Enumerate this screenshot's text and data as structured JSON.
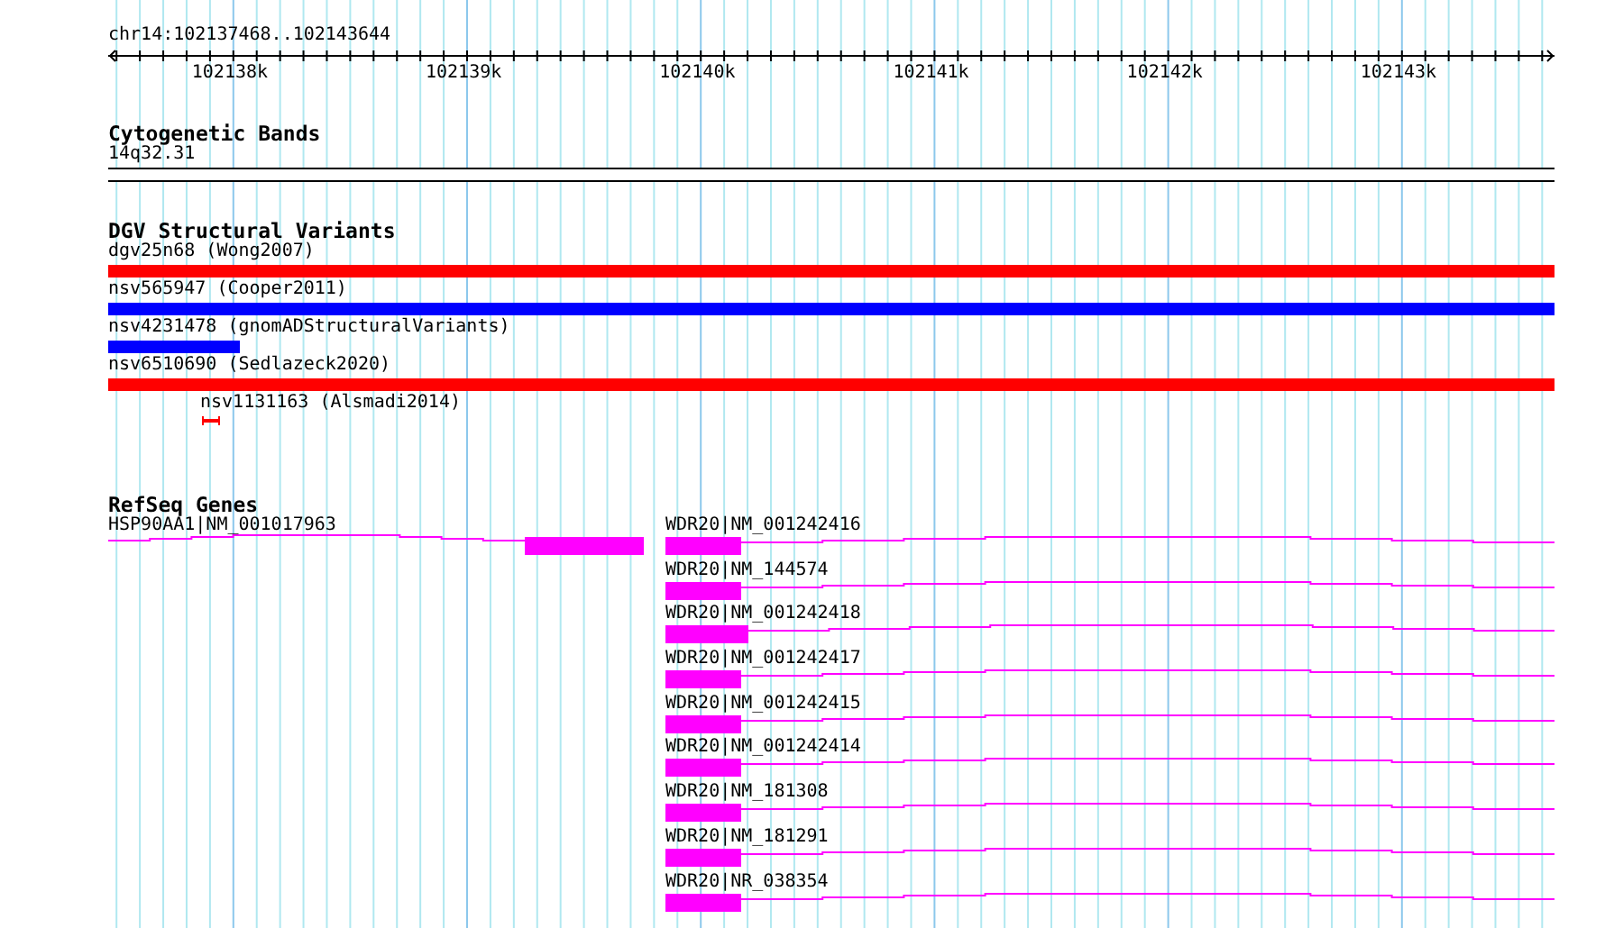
{
  "locus": "chr14:102137468..102143644",
  "ruler": {
    "ticks": [
      "102138k",
      "102139k",
      "102140k",
      "102141k",
      "102142k",
      "102143k"
    ]
  },
  "tracks": [
    {
      "kind": "bands",
      "title": "Cytogenetic Bands",
      "rows": [
        [
          {
            "label": "14q32.31"
          }
        ]
      ]
    },
    {
      "kind": "variants",
      "title": "DGV Structural Variants",
      "rows": [
        [
          {
            "label": "dgv25n68 (Wong2007)",
            "color": "#ff0000"
          }
        ],
        [
          {
            "label": "nsv565947 (Cooper2011)",
            "color": "#0000ff"
          }
        ],
        [
          {
            "label": "nsv4231478 (gnomADStructuralVariants)",
            "color": "#0000ff"
          }
        ],
        [
          {
            "label": "nsv6510690 (Sedlazeck2020)",
            "color": "#ff0000"
          }
        ],
        [
          {
            "label": "nsv1131163 (Alsmadi2014)",
            "color": "#ff0000"
          }
        ]
      ]
    },
    {
      "kind": "genes",
      "title": "RefSeq Genes",
      "rows": [
        [
          {
            "label": "HSP90AA1|NM_001017963"
          },
          {
            "label": "WDR20|NM_001242416"
          }
        ],
        [
          {
            "label": "WDR20|NM_144574"
          }
        ],
        [
          {
            "label": "WDR20|NM_001242418"
          }
        ],
        [
          {
            "label": "WDR20|NM_001242417"
          }
        ],
        [
          {
            "label": "WDR20|NM_001242415"
          }
        ],
        [
          {
            "label": "WDR20|NM_001242414"
          }
        ],
        [
          {
            "label": "WDR20|NM_181308"
          }
        ],
        [
          {
            "label": "WDR20|NM_181291"
          }
        ],
        [
          {
            "label": "WDR20|NR_038354"
          }
        ]
      ]
    }
  ]
}
